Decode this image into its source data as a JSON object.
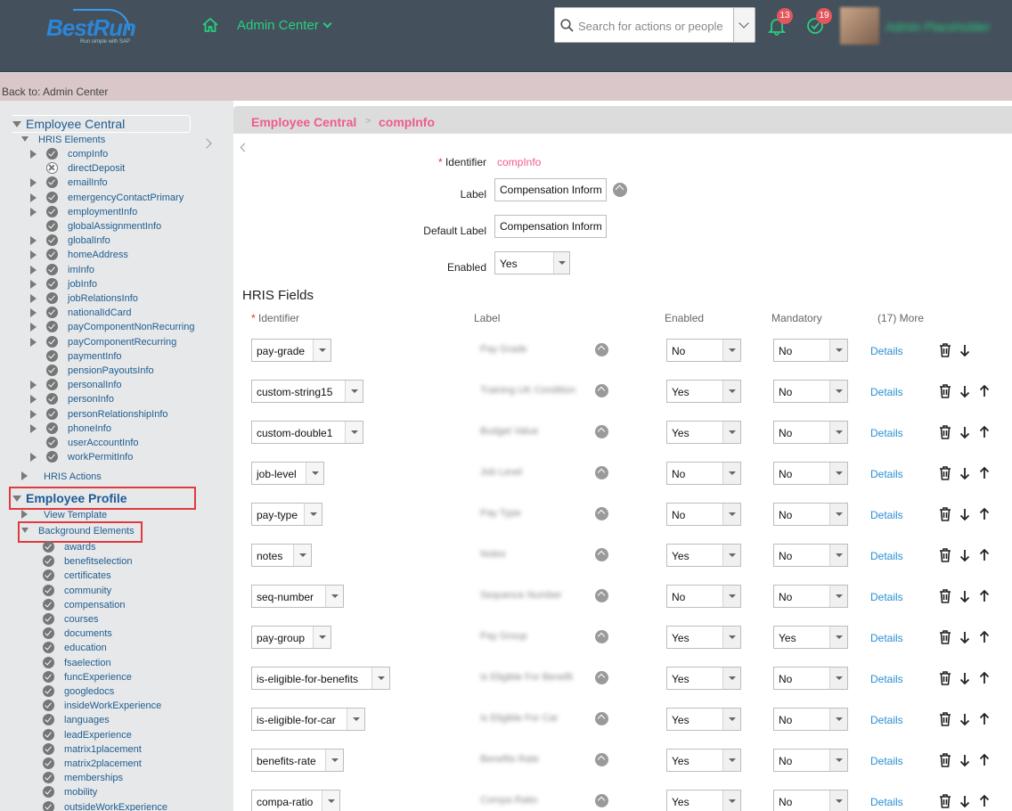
{
  "header": {
    "logo": {
      "brand": "BestRun",
      "tagline": "Run simple with SAP"
    },
    "admin_menu": "Admin Center",
    "search_placeholder": "Search for actions or people",
    "notifications_count": "13",
    "approvals_count": "19",
    "user_name": "Admin Placeholder",
    "accent_color": "#27d07f"
  },
  "back_link": "Back to: Admin Center",
  "sidebar": {
    "employee_central": "Employee Central",
    "hris_elements": "HRIS Elements",
    "hris_items": [
      {
        "label": "compInfo",
        "expandable": true,
        "icon": "check"
      },
      {
        "label": "directDeposit",
        "expandable": false,
        "icon": "x"
      },
      {
        "label": "emailInfo",
        "expandable": true,
        "icon": "check"
      },
      {
        "label": "emergencyContactPrimary",
        "expandable": true,
        "icon": "check"
      },
      {
        "label": "employmentInfo",
        "expandable": true,
        "icon": "check"
      },
      {
        "label": "globalAssignmentInfo",
        "expandable": false,
        "icon": "check"
      },
      {
        "label": "globalInfo",
        "expandable": true,
        "icon": "check"
      },
      {
        "label": "homeAddress",
        "expandable": true,
        "icon": "check"
      },
      {
        "label": "imInfo",
        "expandable": true,
        "icon": "check"
      },
      {
        "label": "jobInfo",
        "expandable": true,
        "icon": "check"
      },
      {
        "label": "jobRelationsInfo",
        "expandable": true,
        "icon": "check"
      },
      {
        "label": "nationalIdCard",
        "expandable": true,
        "icon": "check"
      },
      {
        "label": "payComponentNonRecurring",
        "expandable": true,
        "icon": "check"
      },
      {
        "label": "payComponentRecurring",
        "expandable": true,
        "icon": "check"
      },
      {
        "label": "paymentInfo",
        "expandable": false,
        "icon": "check"
      },
      {
        "label": "pensionPayoutsInfo",
        "expandable": false,
        "icon": "check"
      },
      {
        "label": "personalInfo",
        "expandable": true,
        "icon": "check"
      },
      {
        "label": "personInfo",
        "expandable": true,
        "icon": "check"
      },
      {
        "label": "personRelationshipInfo",
        "expandable": true,
        "icon": "check"
      },
      {
        "label": "phoneInfo",
        "expandable": true,
        "icon": "check"
      },
      {
        "label": "userAccountInfo",
        "expandable": false,
        "icon": "check"
      },
      {
        "label": "workPermitInfo",
        "expandable": true,
        "icon": "check"
      }
    ],
    "hris_actions": "HRIS Actions",
    "employee_profile": "Employee Profile",
    "view_template": "View Template",
    "background_elements": "Background Elements",
    "background_items": [
      "awards",
      "benefitselection",
      "certificates",
      "community",
      "compensation",
      "courses",
      "documents",
      "education",
      "fsaelection",
      "funcExperience",
      "googledocs",
      "insideWorkExperience",
      "languages",
      "leadExperience",
      "matrix1placement",
      "matrix2placement",
      "memberships",
      "mobility",
      "outsideWorkExperience"
    ]
  },
  "main": {
    "breadcrumb": [
      "Employee Central",
      "compInfo"
    ],
    "breadcrumb_sep": ">",
    "form": {
      "identifier_label": "Identifier",
      "identifier_value": "compInfo",
      "label_label": "Label",
      "label_value": "Compensation Information",
      "default_label_label": "Default Label",
      "default_label_value": "Compensation Information",
      "enabled_label": "Enabled",
      "enabled_value": "Yes"
    },
    "hris_fields_title": "HRIS Fields",
    "columns": {
      "identifier": "Identifier",
      "label": "Label",
      "enabled": "Enabled",
      "mandatory": "Mandatory",
      "more": "(17) More"
    },
    "details_label": "Details",
    "rows": [
      {
        "id": "pay-grade",
        "label": "Pay Grade",
        "enabled": "No",
        "mandatory": "No",
        "up": false
      },
      {
        "id": "custom-string15",
        "label": "Training UK Condition",
        "enabled": "Yes",
        "mandatory": "No",
        "up": true
      },
      {
        "id": "custom-double1",
        "label": "Budget Value",
        "enabled": "Yes",
        "mandatory": "No",
        "up": true
      },
      {
        "id": "job-level",
        "label": "Job Level",
        "enabled": "No",
        "mandatory": "No",
        "up": true
      },
      {
        "id": "pay-type",
        "label": "Pay Type",
        "enabled": "No",
        "mandatory": "No",
        "up": true
      },
      {
        "id": "notes",
        "label": "Notes",
        "enabled": "Yes",
        "mandatory": "No",
        "up": true
      },
      {
        "id": "seq-number",
        "label": "Sequence Number",
        "enabled": "No",
        "mandatory": "No",
        "up": true
      },
      {
        "id": "pay-group",
        "label": "Pay Group",
        "enabled": "Yes",
        "mandatory": "Yes",
        "up": true
      },
      {
        "id": "is-eligible-for-benefits",
        "label": "Is Eligible For Benefit",
        "enabled": "Yes",
        "mandatory": "No",
        "up": true
      },
      {
        "id": "is-eligible-for-car",
        "label": "Is Eligible For Car",
        "enabled": "Yes",
        "mandatory": "No",
        "up": true
      },
      {
        "id": "benefits-rate",
        "label": "Benefits Rate",
        "enabled": "Yes",
        "mandatory": "No",
        "up": true
      },
      {
        "id": "compa-ratio",
        "label": "Compa Ratio",
        "enabled": "Yes",
        "mandatory": "No",
        "up": true
      }
    ]
  }
}
